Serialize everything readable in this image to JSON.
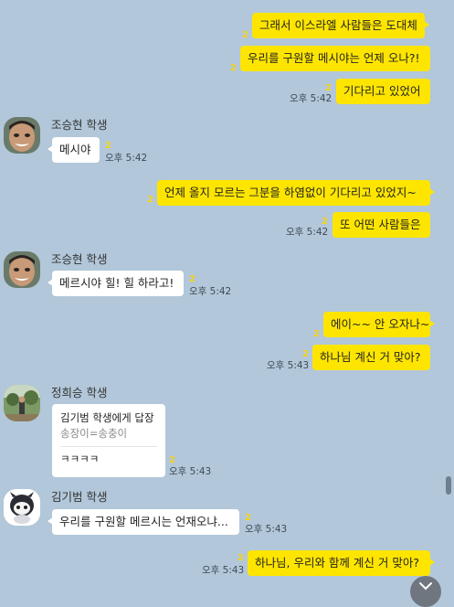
{
  "messages": [
    {
      "type": "mine",
      "text": "그래서 이스라엘 사람들은 도대체",
      "unread": "2",
      "time": ""
    },
    {
      "type": "mine",
      "text": "우리를 구원할 메시야는 언제 오나?!",
      "unread": "2",
      "time": ""
    },
    {
      "type": "mine",
      "text": "기다리고 있었어",
      "unread": "2",
      "time": "오후 5:42"
    },
    {
      "type": "other",
      "name": "조승현 학생",
      "text": "메시야",
      "unread": "2",
      "time": "오후 5:42"
    },
    {
      "type": "mine",
      "text": "언제 올지 모르는 그분을 하염없이 기다리고 있었지~",
      "unread": "2",
      "time": ""
    },
    {
      "type": "mine",
      "text": "또 어떤 사람들은",
      "unread": "2",
      "time": "오후 5:42"
    },
    {
      "type": "other",
      "name": "조승현 학생",
      "text": "메르시야 힐! 힐 하라고!",
      "unread": "2",
      "time": "오후 5:42"
    },
    {
      "type": "mine",
      "text": "에이~~ 안 오자나~",
      "unread": "2",
      "time": ""
    },
    {
      "type": "mine",
      "text": "하나님 계신 거 맞아?",
      "unread": "2",
      "time": "오후 5:43"
    },
    {
      "type": "other-reply",
      "name": "정희승 학생",
      "reply_title": "김기범 학생에게 답장",
      "reply_quote": "송장이=송충이",
      "text": "ㅋㅋㅋㅋ",
      "unread": "2",
      "time": "오후 5:43"
    },
    {
      "type": "other",
      "name": "김기범 학생",
      "text": "우리를 구원할 메르시는 언재오냐...",
      "unread": "2",
      "time": "오후 5:43"
    },
    {
      "type": "mine",
      "text": "하나님, 우리와 함께 계신 거 맞아?",
      "unread": "2",
      "time": "오후 5:43"
    }
  ],
  "colors": {
    "background": "#b2c7d9",
    "my_bubble": "#fee500",
    "other_bubble": "#ffffff",
    "unread": "#f5d317"
  },
  "icons": {
    "scroll_down": "chevron-down-icon"
  }
}
